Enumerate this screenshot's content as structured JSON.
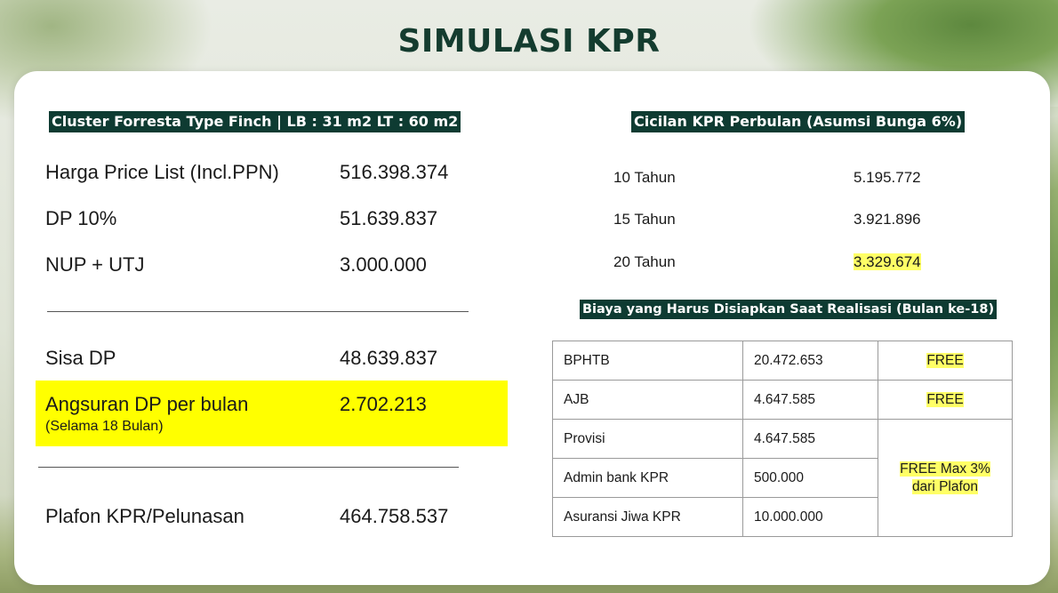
{
  "title": "SIMULASI KPR",
  "colors": {
    "banner": "#0e3b32",
    "title": "#143c2f",
    "highlight": "#ffff00"
  },
  "left": {
    "banner": "Cluster Forresta Type Finch  |  LB : 31 m2 LT : 60 m2",
    "rows": [
      {
        "label": "Harga Price List (Incl.PPN)",
        "value": "516.398.374"
      },
      {
        "label": "DP 10%",
        "value": "51.639.837"
      },
      {
        "label": "NUP + UTJ",
        "value": "3.000.000"
      }
    ],
    "sisa_dp": {
      "label": "Sisa DP",
      "value": "48.639.837"
    },
    "angsuran": {
      "label": "Angsuran DP per bulan",
      "note": "(Selama 18 Bulan)",
      "value": "2.702.213"
    },
    "plafon": {
      "label": "Plafon KPR/Pelunasan",
      "value": "464.758.537"
    }
  },
  "right": {
    "cicilan_banner": "Cicilan KPR Perbulan (Asumsi Bunga 6%)",
    "cicilan": [
      {
        "tenor": "10 Tahun",
        "amount": "5.195.772"
      },
      {
        "tenor": "15 Tahun",
        "amount": "3.921.896"
      },
      {
        "tenor": "20 Tahun",
        "amount": "3.329.674"
      }
    ],
    "biaya_banner": "Biaya yang Harus Disiapkan Saat Realisasi (Bulan ke-18)",
    "biaya": [
      {
        "item": "BPHTB",
        "amount": "20.472.653",
        "note": "FREE"
      },
      {
        "item": "AJB",
        "amount": "4.647.585",
        "note": "FREE"
      },
      {
        "item": "Provisi",
        "amount": "4.647.585"
      },
      {
        "item": "Admin bank KPR",
        "amount": "500.000"
      },
      {
        "item": "Asuransi Jiwa KPR",
        "amount": "10.000.000"
      }
    ],
    "biaya_group_note_line1": "FREE Max 3%",
    "biaya_group_note_line2": "dari Plafon"
  }
}
